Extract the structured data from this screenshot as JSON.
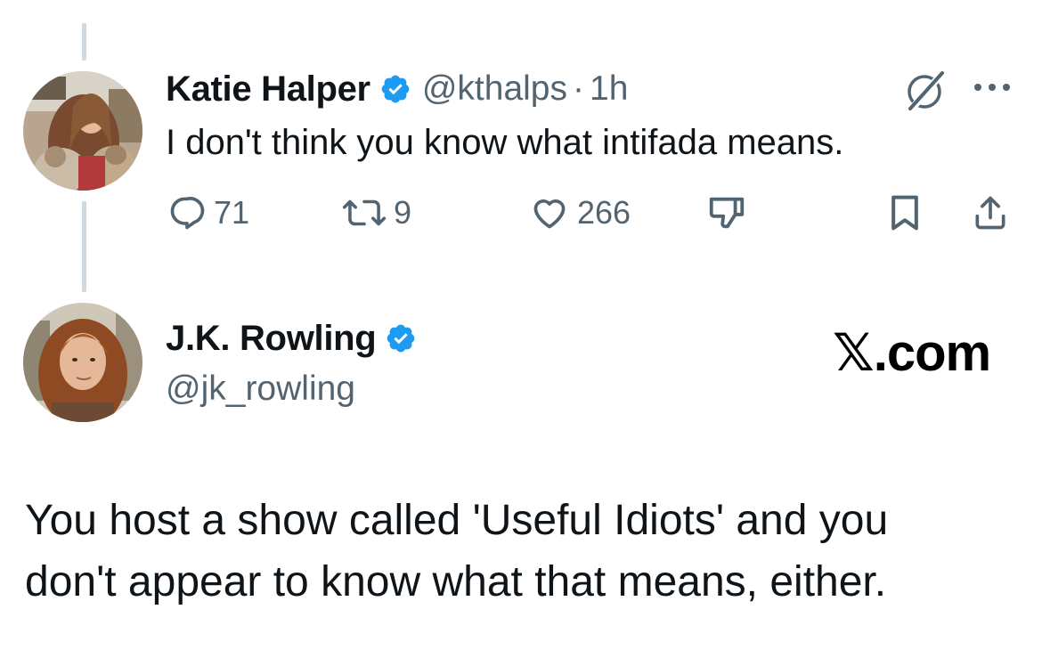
{
  "reply_tweet": {
    "author_name": "Katie Halper",
    "verified": true,
    "handle": "@kthalps",
    "separator": "·",
    "time": "1h",
    "text": "I don't think you know what intifada means.",
    "counts": {
      "replies": "71",
      "reposts": "9",
      "likes": "266"
    }
  },
  "response_tweet": {
    "author_name": "J.K. Rowling",
    "verified": true,
    "handle": "@jk_rowling",
    "text_line_1": "You host a show called 'Useful Idiots' and you",
    "text_line_2": "don't appear to know what that means, either."
  },
  "watermark": {
    "x_logo": "𝕏",
    "suffix": ".com"
  },
  "icons": {
    "reply": "reply-icon",
    "repost": "repost-icon",
    "like": "heart-icon",
    "dislike": "thumbs-down-icon",
    "bookmark": "bookmark-icon",
    "share": "share-icon",
    "grok": "grok-slash-icon",
    "more": "more-icon",
    "verified": "verified-badge-icon"
  },
  "colors": {
    "text_primary": "#0f1419",
    "text_secondary": "#536471",
    "verified_blue": "#1d9bf0",
    "thread_line": "#cfd9de"
  }
}
